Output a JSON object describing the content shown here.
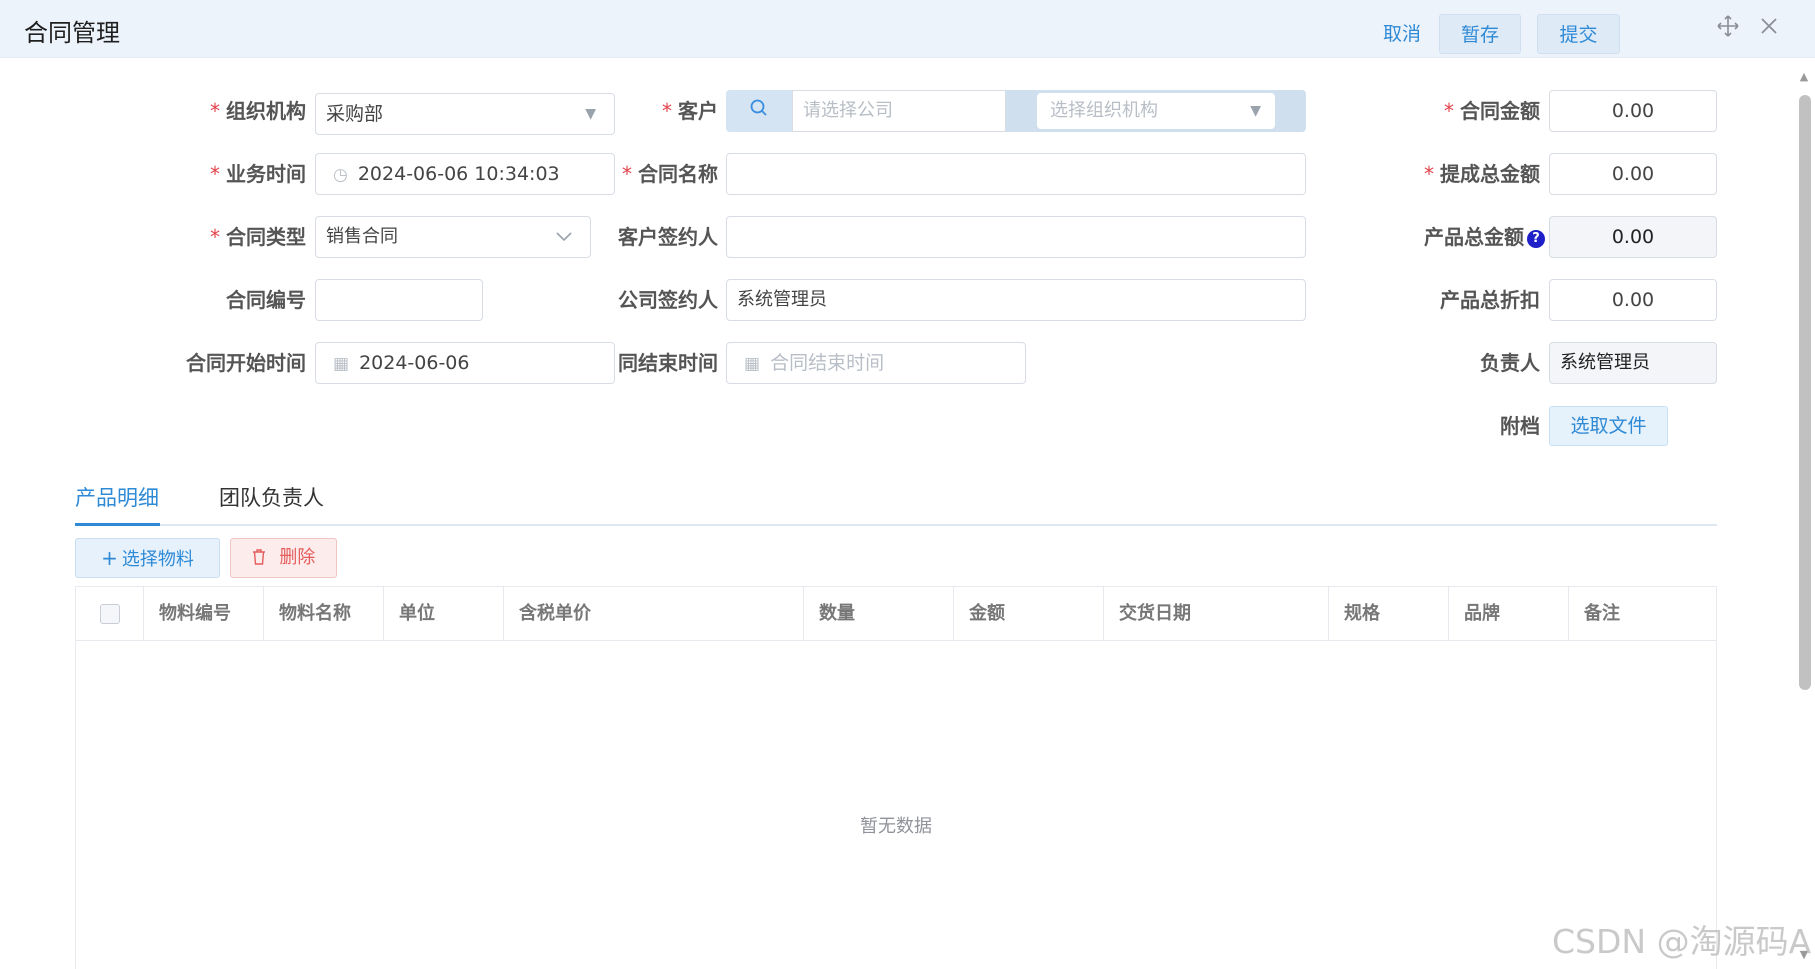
{
  "header": {
    "title": "合同管理",
    "cancel": "取消",
    "save_draft": "暂存",
    "submit": "提交"
  },
  "form": {
    "org": {
      "label": "组织机构",
      "value": "采购部"
    },
    "customer": {
      "label": "客户",
      "company_placeholder": "请选择公司",
      "org_placeholder": "选择组织机构"
    },
    "contract_amount": {
      "label": "合同金额",
      "value": "0.00"
    },
    "biz_time": {
      "label": "业务时间",
      "value": "2024-06-06 10:34:03"
    },
    "contract_name": {
      "label": "合同名称",
      "value": ""
    },
    "commission_total": {
      "label": "提成总金额",
      "value": "0.00"
    },
    "contract_type": {
      "label": "合同类型",
      "value": "销售合同"
    },
    "customer_signer": {
      "label": "客户签约人",
      "value": ""
    },
    "product_total": {
      "label": "产品总金额",
      "value": "0.00",
      "help": "?"
    },
    "contract_no": {
      "label": "合同编号",
      "value": ""
    },
    "company_signer": {
      "label": "公司签约人",
      "value": "系统管理员"
    },
    "product_discount": {
      "label": "产品总折扣",
      "value": "0.00"
    },
    "start_time": {
      "label": "合同开始时间",
      "value": "2024-06-06"
    },
    "end_time": {
      "label": "同结束时间",
      "placeholder": "合同结束时间"
    },
    "owner": {
      "label": "负责人",
      "value": "系统管理员"
    },
    "attachment": {
      "label": "附档",
      "button": "选取文件"
    }
  },
  "tabs": [
    {
      "label": "产品明细",
      "active": true
    },
    {
      "label": "团队负责人",
      "active": false
    }
  ],
  "toolbar": {
    "add": "选择物料",
    "delete": "删除"
  },
  "table": {
    "columns": [
      "物料编号",
      "物料名称",
      "单位",
      "含税单价",
      "数量",
      "金额",
      "交货日期",
      "规格",
      "品牌",
      "备注"
    ],
    "empty_text": "暂无数据"
  },
  "watermark": "CSDN @淘源码A"
}
